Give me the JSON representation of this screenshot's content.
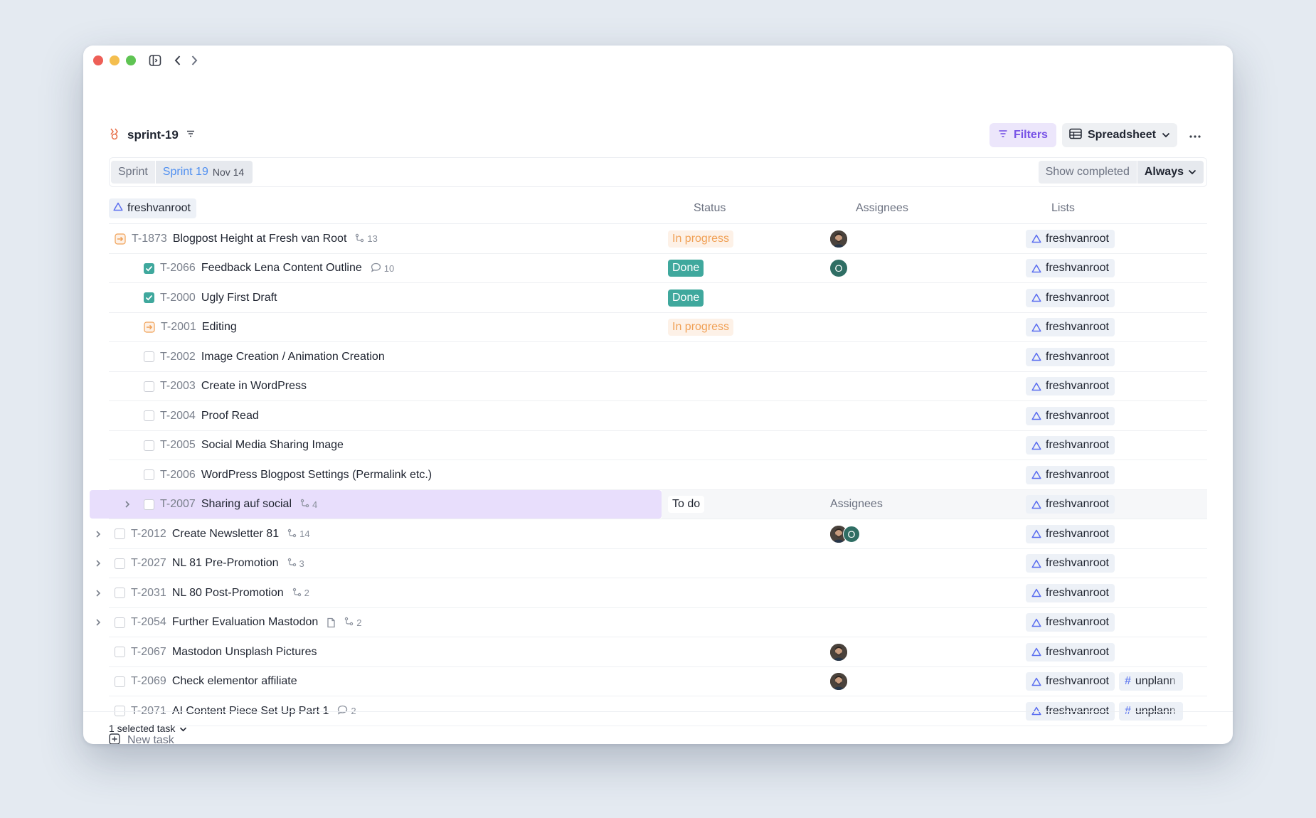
{
  "header": {
    "project_name": "sprint-19",
    "filters_label": "Filters",
    "view_label": "Spreadsheet"
  },
  "filterbar": {
    "sprint_field": "Sprint",
    "sprint_value": "Sprint 19",
    "sprint_date": "Nov 14",
    "show_completed_label": "Show completed",
    "show_completed_value": "Always"
  },
  "table": {
    "group_name": "freshvanroot",
    "columns": {
      "status": "Status",
      "assignees": "Assignees",
      "lists": "Lists"
    },
    "rows": [
      {
        "id": "T-1873",
        "name": "Blogpost Height at Fresh van Root",
        "meta_icon": "subtask-icon",
        "meta_count": "13",
        "status": "In progress",
        "assignees": [
          "photo"
        ],
        "list": "freshvanroot"
      },
      {
        "id": "T-2066",
        "name": "Feedback Lena Content Outline",
        "meta_icon": "comment-icon",
        "meta_count": "10",
        "status": "Done",
        "assignees": [
          "O"
        ],
        "list": "freshvanroot"
      },
      {
        "id": "T-2000",
        "name": "Ugly First Draft",
        "status": "Done",
        "list": "freshvanroot"
      },
      {
        "id": "T-2001",
        "name": "Editing",
        "status": "In progress",
        "list": "freshvanroot"
      },
      {
        "id": "T-2002",
        "name": "Image Creation / Animation Creation",
        "list": "freshvanroot"
      },
      {
        "id": "T-2003",
        "name": "Create in WordPress",
        "list": "freshvanroot"
      },
      {
        "id": "T-2004",
        "name": "Proof Read",
        "list": "freshvanroot"
      },
      {
        "id": "T-2005",
        "name": "Social Media Sharing Image",
        "list": "freshvanroot"
      },
      {
        "id": "T-2006",
        "name": "WordPress Blogpost Settings (Permalink etc.)",
        "list": "freshvanroot"
      },
      {
        "id": "T-2007",
        "name": "Sharing auf social",
        "meta_icon": "subtask-icon",
        "meta_count": "4",
        "status": "To do",
        "assignees_placeholder": "Assignees",
        "list": "freshvanroot"
      },
      {
        "id": "T-2012",
        "name": "Create Newsletter 81",
        "meta_icon": "subtask-icon",
        "meta_count": "14",
        "assignees": [
          "photo",
          "O"
        ],
        "list": "freshvanroot"
      },
      {
        "id": "T-2027",
        "name": "NL 81 Pre-Promotion",
        "meta_icon": "subtask-icon",
        "meta_count": "3",
        "list": "freshvanroot"
      },
      {
        "id": "T-2031",
        "name": "NL 80 Post-Promotion",
        "meta_icon": "subtask-icon",
        "meta_count": "2",
        "list": "freshvanroot"
      },
      {
        "id": "T-2054",
        "name": "Further Evaluation Mastodon",
        "meta_icon": "subtask-icon",
        "meta_count": "2",
        "list": "freshvanroot"
      },
      {
        "id": "T-2067",
        "name": "Mastodon Unsplash Pictures",
        "assignees": [
          "photo"
        ],
        "list": "freshvanroot"
      },
      {
        "id": "T-2069",
        "name": "Check elementor affiliate",
        "assignees": [
          "photo"
        ],
        "list": "freshvanroot",
        "tag": "unplann"
      },
      {
        "id": "T-2071",
        "name": "AI Content Piece Set Up Part 1",
        "meta_icon": "comment-icon",
        "meta_count": "2",
        "list": "freshvanroot",
        "tag": "unplann"
      }
    ],
    "new_task_label": "New task"
  },
  "footer": {
    "selection_label": "1 selected task"
  }
}
